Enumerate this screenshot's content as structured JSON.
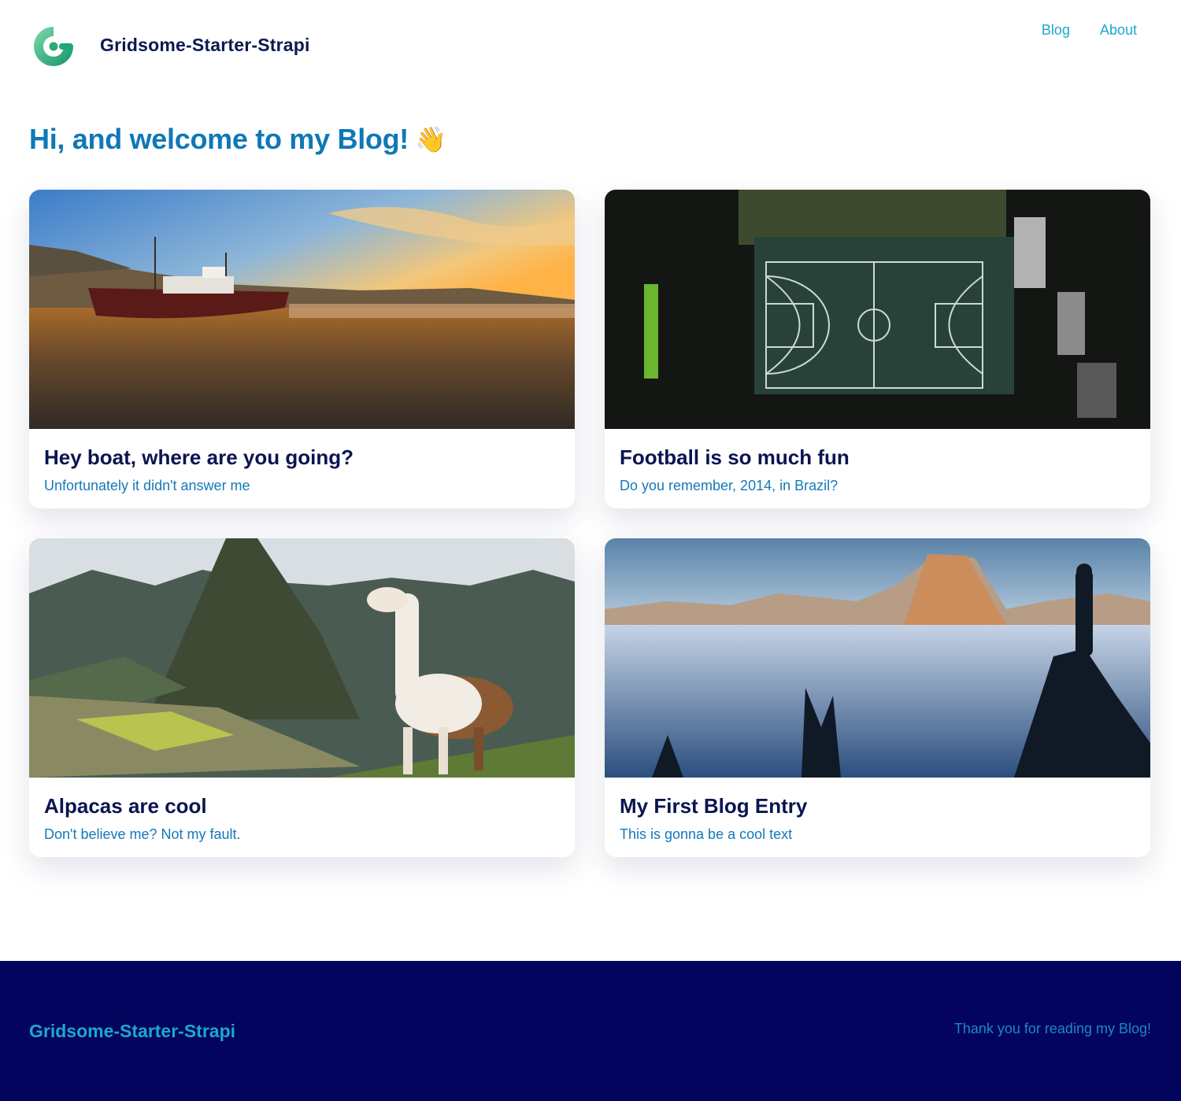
{
  "header": {
    "logo_icon": "gridsome-logo",
    "site_title": "Gridsome-Starter-Strapi",
    "nav": [
      "Blog",
      "About"
    ]
  },
  "main": {
    "heading": "Hi, and welcome to my Blog!",
    "heading_emoji": "👋",
    "posts": [
      {
        "title": "Hey boat, where are you going?",
        "description": "Unfortunately it didn't answer me"
      },
      {
        "title": "Football is so much fun",
        "description": "Do you remember, 2014, in Brazil?"
      },
      {
        "title": "Alpacas are cool",
        "description": "Don't believe me? Not my fault."
      },
      {
        "title": "My First Blog Entry",
        "description": "This is gonna be a cool text"
      }
    ]
  },
  "footer": {
    "site_title": "Gridsome-Starter-Strapi",
    "text": "Thank you for reading my Blog!"
  },
  "colors": {
    "brand_dark": "#0b1451",
    "accent": "#1ba7d1",
    "heading": "#0f78b6",
    "footer_bg": "#03045e"
  }
}
